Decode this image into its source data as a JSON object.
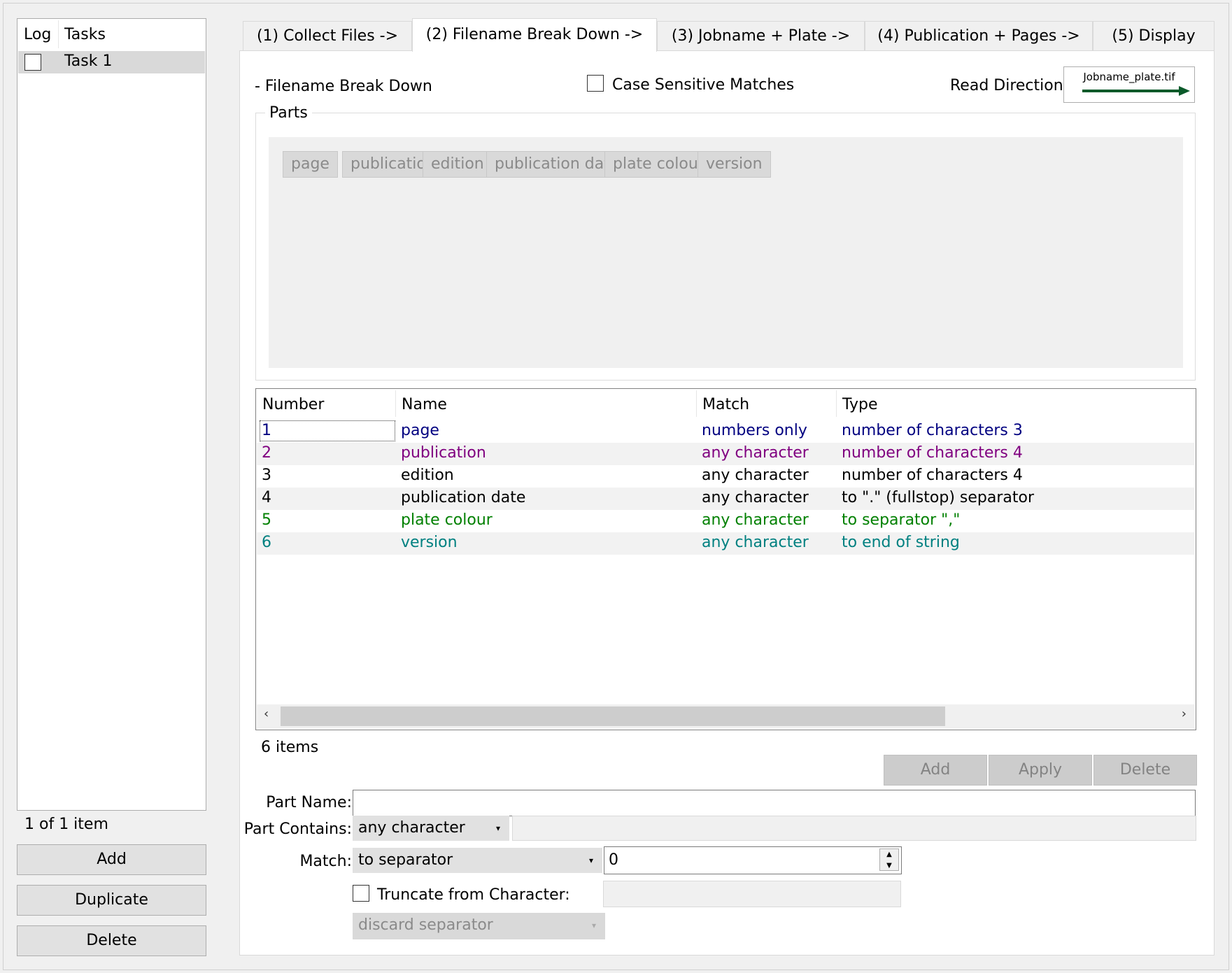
{
  "tasks_panel": {
    "col_log": "Log",
    "col_tasks": "Tasks",
    "rows": [
      {
        "label": "Task 1",
        "checked": false
      }
    ],
    "count_text": "1 of 1 item",
    "add_label": "Add",
    "duplicate_label": "Duplicate",
    "delete_label": "Delete"
  },
  "tabs": [
    {
      "label": "(1) Collect Files ->",
      "active": false
    },
    {
      "label": "(2) Filename Break Down ->",
      "active": true
    },
    {
      "label": "(3) Jobname + Plate ->",
      "active": false
    },
    {
      "label": "(4) Publication + Pages ->",
      "active": false
    },
    {
      "label": "(5) Display",
      "active": false
    }
  ],
  "breakdown": {
    "section_title": "- Filename Break Down",
    "case_sensitive_label": "Case Sensitive Matches",
    "case_sensitive_checked": false,
    "read_direction_label": "Read Direction:",
    "read_direction_example": "Jobname_plate.tif",
    "read_direction_arrow_color": "#0a5a2a",
    "parts_title": "Parts",
    "parts": [
      "page",
      "publication",
      "edition",
      "publication date",
      "plate colour",
      "version"
    ]
  },
  "table": {
    "headers": [
      "Number",
      "Name",
      "Match",
      "Type"
    ],
    "rows": [
      {
        "number": "1",
        "name": "page",
        "match": "numbers only",
        "type": "number of characters 3",
        "color": "#000080"
      },
      {
        "number": "2",
        "name": "publication",
        "match": "any character",
        "type": "number of characters 4",
        "color": "#800080"
      },
      {
        "number": "3",
        "name": "edition",
        "match": "any character",
        "type": "number of characters 4",
        "color": "#000000"
      },
      {
        "number": "4",
        "name": "publication date",
        "match": "any character",
        "type": "to \".\" (fullstop) separator",
        "color": "#000000"
      },
      {
        "number": "5",
        "name": "plate colour",
        "match": "any character",
        "type": "to separator \",\"",
        "color": "#008000"
      },
      {
        "number": "6",
        "name": "version",
        "match": "any character",
        "type": "to end of string",
        "color": "#008080"
      }
    ],
    "items_text": "6 items"
  },
  "actions": {
    "add": "Add",
    "apply": "Apply",
    "delete": "Delete"
  },
  "form": {
    "part_name_label": "Part Name:",
    "part_name_value": "",
    "part_contains_label": "Part Contains:",
    "part_contains_value": "any character",
    "part_contains_extra": "",
    "match_label": "Match:",
    "match_value": "to separator",
    "match_number": "0",
    "truncate_label": "Truncate from Character:",
    "truncate_checked": false,
    "truncate_value": "",
    "separator_option": "discard separator"
  }
}
